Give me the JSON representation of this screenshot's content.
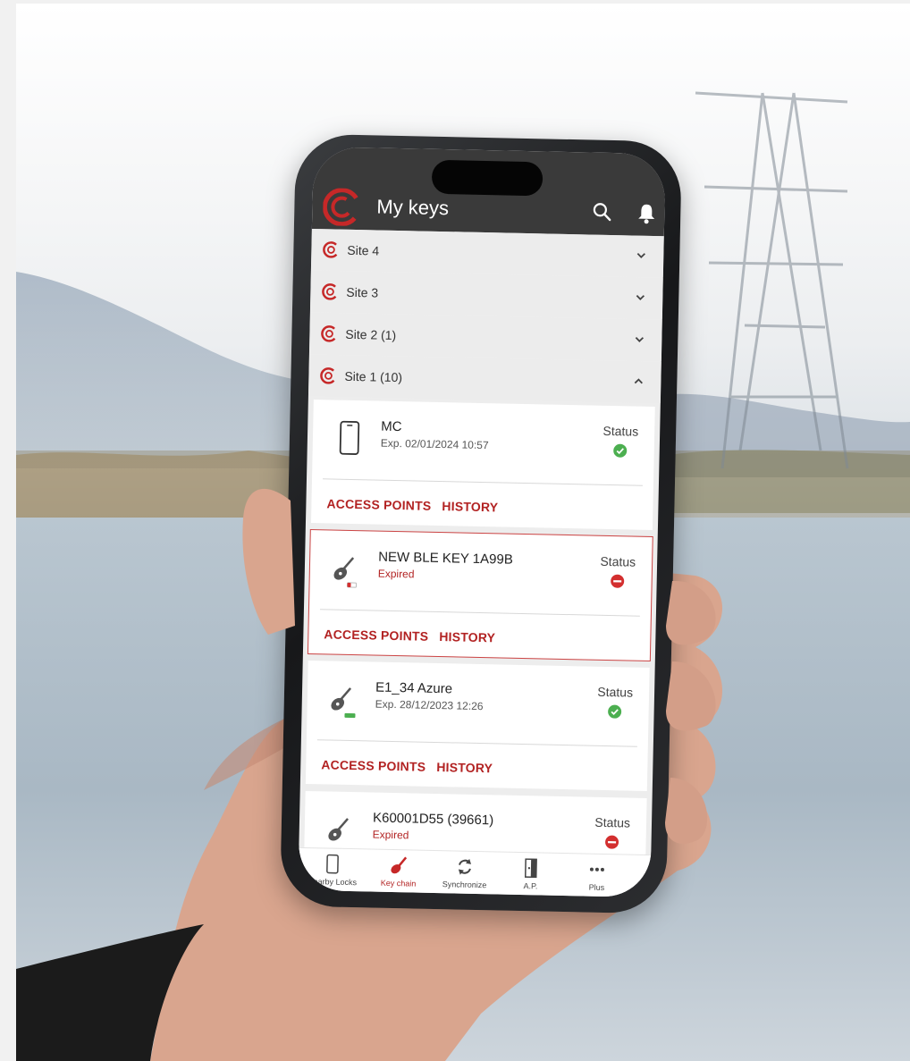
{
  "app": {
    "title": "My keys"
  },
  "sites": [
    {
      "label": "Site 4",
      "expanded": false
    },
    {
      "label": "Site 3",
      "expanded": false
    },
    {
      "label": "Site 2 (1)",
      "expanded": false
    },
    {
      "label": "Site 1 (10)",
      "expanded": true
    }
  ],
  "keys": [
    {
      "name": "MC",
      "subtitle": "Exp. 02/01/2024 10:57",
      "status_label": "Status",
      "status": "valid",
      "icon": "phone-icon",
      "access_points": "ACCESS POINTS",
      "history": "HISTORY"
    },
    {
      "name": "NEW BLE KEY 1A99B",
      "subtitle": "Expired",
      "status_label": "Status",
      "status": "blocked",
      "icon": "key-fob-icon",
      "access_points": "ACCESS POINTS",
      "history": "HISTORY"
    },
    {
      "name": "E1_34 Azure",
      "subtitle": "Exp. 28/12/2023 12:26",
      "status_label": "Status",
      "status": "valid",
      "icon": "key-fob-icon",
      "access_points": "ACCESS POINTS",
      "history": "HISTORY"
    },
    {
      "name": "K60001D55 (39661)",
      "subtitle": "Expired",
      "status_label": "Status",
      "status": "blocked",
      "icon": "key-fob-icon"
    }
  ],
  "nav": [
    {
      "label": "Nearby Locks",
      "icon": "phone-icon",
      "active": false
    },
    {
      "label": "Key chain",
      "icon": "key-icon",
      "active": true
    },
    {
      "label": "Synchronize",
      "icon": "sync-icon",
      "active": false
    },
    {
      "label": "A.P.",
      "icon": "door-icon",
      "active": false
    },
    {
      "label": "Plus",
      "icon": "more-icon",
      "active": false
    }
  ],
  "colors": {
    "accent": "#b22222",
    "appbar": "#3a3a3a",
    "valid": "#4caf50",
    "blocked": "#d32f2f"
  }
}
